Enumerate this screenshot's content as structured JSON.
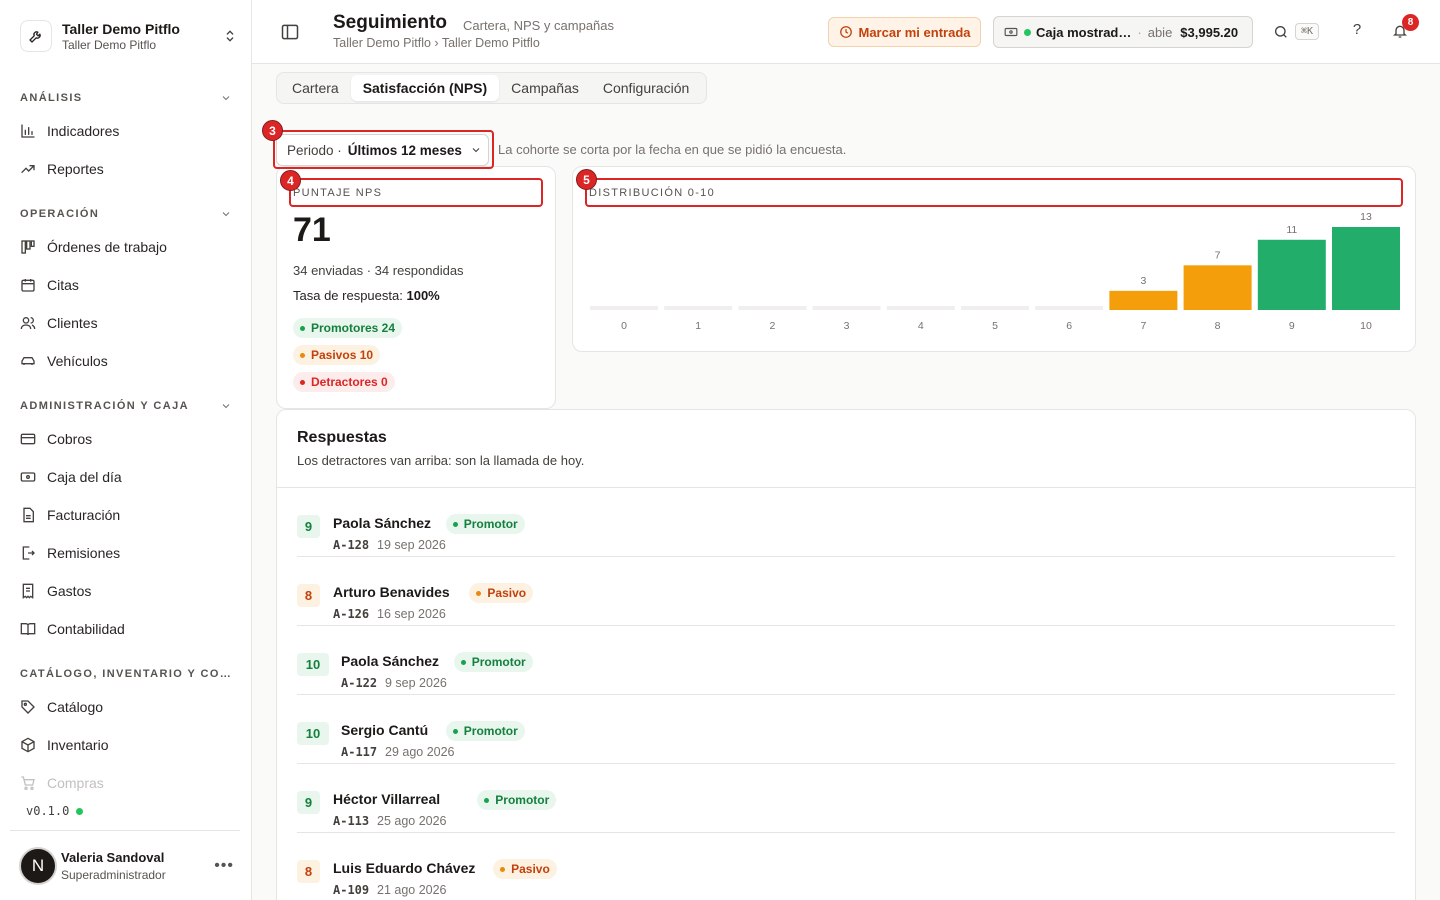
{
  "workspace": {
    "name": "Taller Demo Pitflo",
    "subtitle": "Taller Demo Pitflo"
  },
  "sidebar": {
    "sections": [
      {
        "title": "ANÁLISIS",
        "items": [
          "Indicadores",
          "Reportes"
        ]
      },
      {
        "title": "OPERACIÓN",
        "items": [
          "Órdenes de trabajo",
          "Citas",
          "Clientes",
          "Vehículos"
        ]
      },
      {
        "title": "ADMINISTRACIÓN Y CAJA",
        "items": [
          "Cobros",
          "Caja del día",
          "Facturación",
          "Remisiones",
          "Gastos",
          "Contabilidad"
        ]
      },
      {
        "title": "CATÁLOGO, INVENTARIO Y CO…",
        "items": [
          "Catálogo",
          "Inventario",
          "Compras"
        ]
      }
    ],
    "version": "v0.1.0",
    "user": {
      "initial": "N",
      "name": "Valeria Sandoval",
      "role": "Superadministrador"
    }
  },
  "header": {
    "title": "Seguimiento",
    "subtitle": "Cartera, NPS y campañas",
    "breadcrumb": "Taller Demo Pitflo › Taller Demo Pitflo",
    "clock_in": "Marcar mi entrada",
    "cash": {
      "name": "Caja mostrad…",
      "separator": "·",
      "status": "abie",
      "amount": "$3,995.20"
    },
    "shortcut": "⌘K",
    "help": "?",
    "notifications": "8"
  },
  "tabs": [
    "Cartera",
    "Satisfacción (NPS)",
    "Campañas",
    "Configuración"
  ],
  "period": {
    "label": "Periodo ·",
    "value": "Últimos 12 meses",
    "note": "La cohorte se corta por la fecha en que se pidió la encuesta."
  },
  "annotations": [
    "3",
    "4",
    "5"
  ],
  "nps": {
    "label": "PUNTAJE NPS",
    "score": "71",
    "counts": "34 enviadas · 34 respondidas",
    "rate_label": "Tasa de respuesta:",
    "rate_value": "100%",
    "promoters": "Promotores 24",
    "passives": "Pasivos 10",
    "detractors": "Detractores 0"
  },
  "distribution_label": "DISTRIBUCIÓN 0-10",
  "chart_data": {
    "type": "bar",
    "categories": [
      "0",
      "1",
      "2",
      "3",
      "4",
      "5",
      "6",
      "7",
      "8",
      "9",
      "10"
    ],
    "values": [
      0,
      0,
      0,
      0,
      0,
      0,
      0,
      3,
      7,
      11,
      13
    ],
    "ylim": [
      0,
      13
    ],
    "colors": {
      "empty": "#f0efee",
      "passive": "#f59e0b",
      "promoter": "#22ae6a"
    }
  },
  "responses": {
    "title": "Respuestas",
    "subtitle": "Los detractores van arriba: son la llamada de hoy.",
    "items": [
      {
        "score": "9",
        "name": "Paola Sánchez",
        "tag": "Promotor",
        "kind": "promoter",
        "code": "A-128",
        "date": "19 sep 2026"
      },
      {
        "score": "8",
        "name": "Arturo Benavides",
        "tag": "Pasivo",
        "kind": "passive",
        "code": "A-126",
        "date": "16 sep 2026"
      },
      {
        "score": "10",
        "name": "Paola Sánchez",
        "tag": "Promotor",
        "kind": "promoter",
        "code": "A-122",
        "date": "9 sep 2026"
      },
      {
        "score": "10",
        "name": "Sergio Cantú",
        "tag": "Promotor",
        "kind": "promoter",
        "code": "A-117",
        "date": "29 ago 2026"
      },
      {
        "score": "9",
        "name": "Héctor Villarreal",
        "tag": "Promotor",
        "kind": "promoter",
        "code": "A-113",
        "date": "25 ago 2026"
      },
      {
        "score": "8",
        "name": "Luis Eduardo Chávez",
        "tag": "Pasivo",
        "kind": "passive",
        "code": "A-109",
        "date": "21 ago 2026"
      }
    ]
  }
}
